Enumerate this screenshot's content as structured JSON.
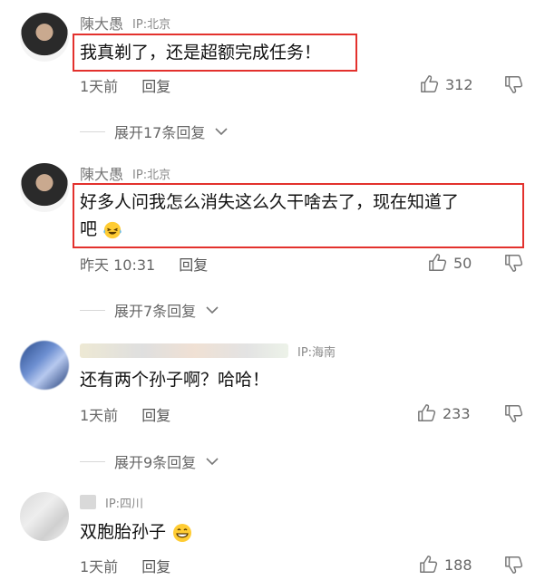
{
  "comments": [
    {
      "user": "陳大愚",
      "ip": "IP:北京",
      "text": "我真剃了，还是超额完成任务！",
      "time": "1天前",
      "reply": "回复",
      "likes": "312",
      "expand": "展开17条回复"
    },
    {
      "user": "陳大愚",
      "ip": "IP:北京",
      "text_line1": "好多人问我怎么消失这么久干啥去了，现在知道了",
      "text_line2": "吧",
      "time": "昨天 10:31",
      "reply": "回复",
      "likes": "50",
      "expand": "展开7条回复"
    },
    {
      "user": "",
      "ip": "IP:海南",
      "text": "还有两个孙子啊？哈哈！",
      "time": "1天前",
      "reply": "回复",
      "likes": "233",
      "expand": "展开9条回复"
    },
    {
      "user": "",
      "ip": "IP:四川",
      "text": "双胞胎孙子",
      "time": "1天前",
      "reply": "回复",
      "likes": "188"
    }
  ],
  "icons": {
    "like": "thumbs-up-icon",
    "dislike": "thumbs-down-icon",
    "expand": "chevron-down-icon",
    "emoji1": "laughing-tears-emoji",
    "emoji2": "grinning-emoji"
  },
  "colors": {
    "highlight": "#e3312d"
  }
}
